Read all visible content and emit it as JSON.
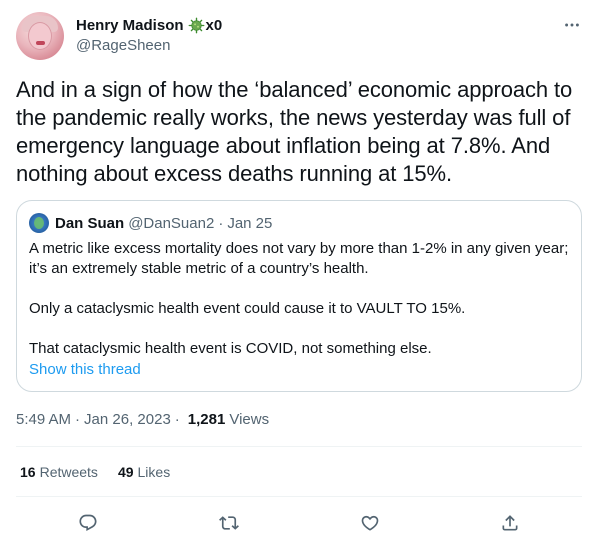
{
  "author": {
    "display_name": "Henry Madison",
    "name_suffix": "x0",
    "handle": "@RageSheen"
  },
  "tweet": {
    "text": "And in a sign of how the ‘balanced’ economic approach to the pandemic really works, the news yesterday was full of emergency language about inflation being at 7.8%. And nothing about excess deaths running at 15%."
  },
  "quote": {
    "display_name": "Dan Suan",
    "handle": "@DanSuan2",
    "separator": "·",
    "date": "Jan 25",
    "paragraphs": [
      "A metric like excess mortality does not vary by more than 1-2% in any given year; it’s an extremely stable metric of a country’s health.",
      "Only a cataclysmic health event could cause it to VAULT TO 15%.",
      "That cataclysmic health event is COVID, not something else."
    ],
    "show_thread_label": "Show this thread"
  },
  "meta": {
    "time": "5:49 AM",
    "separator": "·",
    "date": "Jan 26, 2023",
    "views_count": "1,281",
    "views_label": "Views"
  },
  "stats": {
    "retweets_count": "16",
    "retweets_label": "Retweets",
    "likes_count": "49",
    "likes_label": "Likes"
  },
  "icons": {
    "name_emoji": "virus-icon",
    "more": "more-icon",
    "reply": "reply-icon",
    "retweet": "retweet-icon",
    "like": "heart-icon",
    "share": "share-icon"
  },
  "colors": {
    "text_primary": "#0f1419",
    "text_secondary": "#536471",
    "link": "#1d9bf0",
    "border": "#cfd9de",
    "divider": "#eff3f4",
    "virus_green": "#3d8b2f"
  }
}
